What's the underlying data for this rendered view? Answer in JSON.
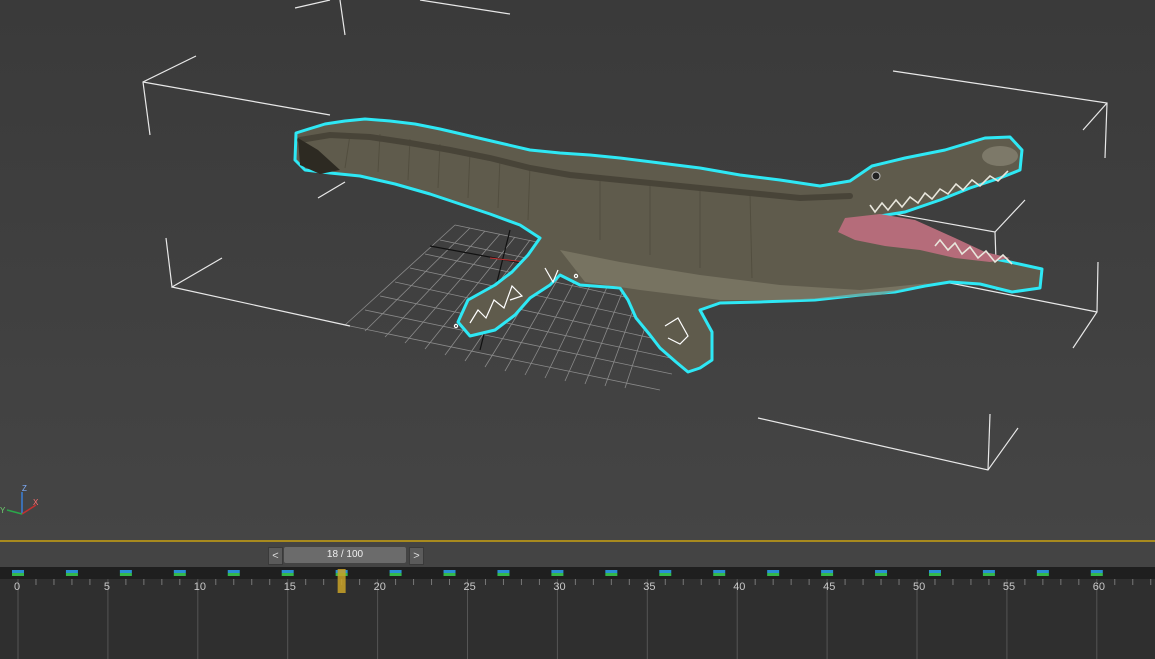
{
  "viewport": {
    "object_name": "crocodile",
    "axis_labels": {
      "z": "Z",
      "x": "X",
      "y": "Y"
    },
    "colors": {
      "selection_outline": "#2ee8f5",
      "bounding_box": "#e8e8e8",
      "grid": "#8a8a8a",
      "croc_body": "#5f5b4c",
      "croc_mouth": "#b56c7a"
    }
  },
  "time_slider": {
    "prev_label": "<",
    "next_label": ">",
    "position_text": "18 / 100",
    "current_frame": 18,
    "total_frames": 100
  },
  "trackbar": {
    "tick_labels": [
      "0",
      "5",
      "10",
      "15",
      "20",
      "25",
      "30",
      "35",
      "40",
      "45",
      "50",
      "55",
      "60"
    ],
    "keyframe_color_top": "#2a8fd4",
    "keyframe_color_mid": "#34b84a",
    "playhead_color": "#c9a227"
  }
}
